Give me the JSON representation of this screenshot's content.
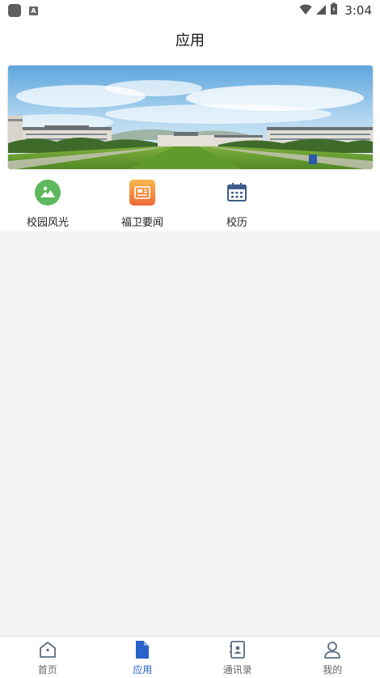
{
  "status_bar": {
    "time": "3:04",
    "a_badge": "A"
  },
  "header": {
    "title": "应用"
  },
  "banner": {
    "alt": "campus"
  },
  "apps": [
    {
      "label": "校园风光",
      "icon": "landscape-icon"
    },
    {
      "label": "福卫要闻",
      "icon": "newspaper-icon"
    },
    {
      "label": "校历",
      "icon": "calendar-icon"
    }
  ],
  "bottom_nav": [
    {
      "label": "首页",
      "icon": "home-icon",
      "active": false
    },
    {
      "label": "应用",
      "icon": "document-icon",
      "active": true
    },
    {
      "label": "通讯录",
      "icon": "contacts-icon",
      "active": false
    },
    {
      "label": "我的",
      "icon": "person-icon",
      "active": false
    }
  ],
  "colors": {
    "accent": "#2962c9",
    "inactive": "#5d6b82",
    "landscape_green": "#5cb85c",
    "news_orange": "#f07a3a"
  }
}
